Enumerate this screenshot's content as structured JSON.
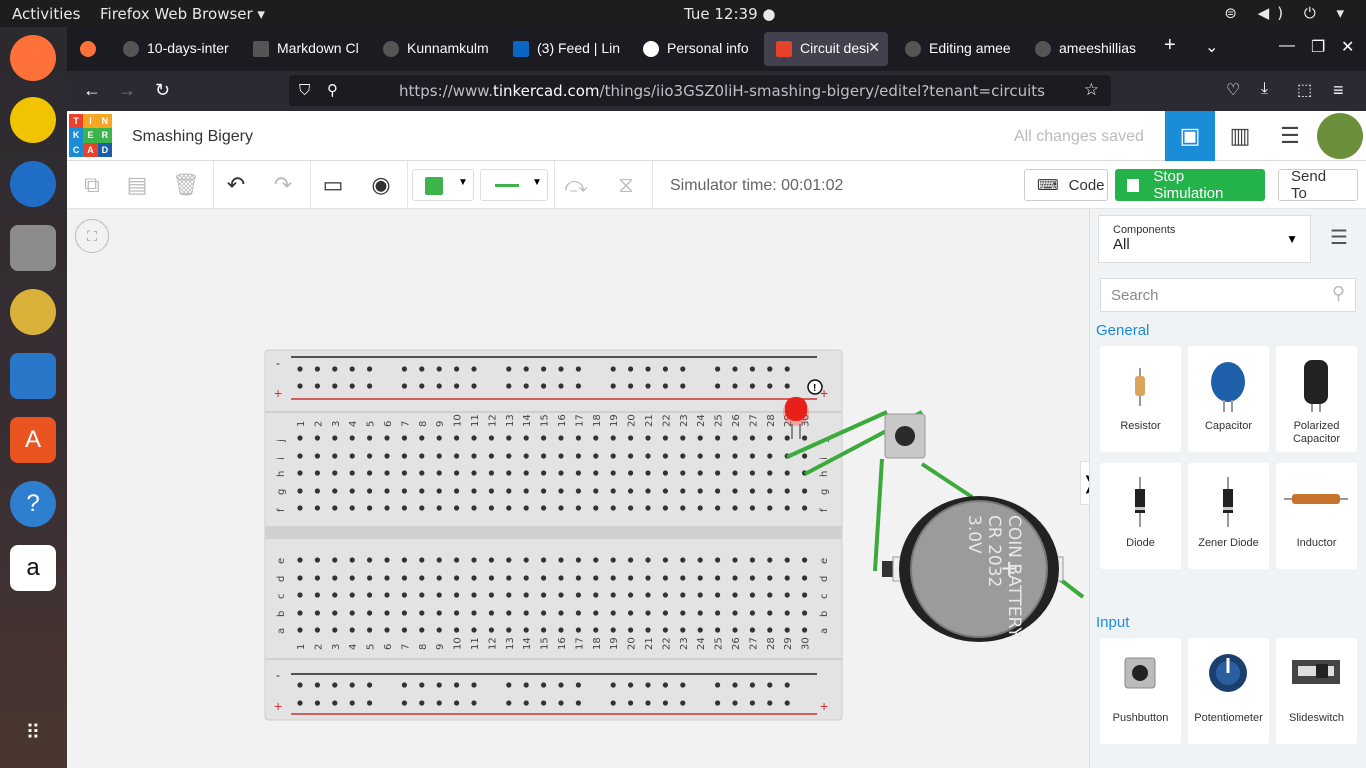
{
  "os": {
    "activities": "Activities",
    "app_menu": "Firefox Web Browser ▾",
    "clock": "Tue 12:39 ●",
    "tray": "⊜ ◀) ⏻ ▾"
  },
  "dock": {
    "items": [
      "firefox-icon",
      "teapot-icon",
      "thunderbird-icon",
      "files-icon",
      "rhythmbox-icon",
      "writer-icon",
      "software-icon",
      "help-icon",
      "amazon-icon",
      "apps-grid-icon"
    ]
  },
  "tabs": [
    {
      "label": "10-days-inter",
      "active": false
    },
    {
      "label": "Markdown Cl",
      "active": false
    },
    {
      "label": "Kunnamkulm",
      "active": false
    },
    {
      "label": "(3) Feed | Lin",
      "active": false
    },
    {
      "label": "Personal info",
      "active": false
    },
    {
      "label": "Circuit desi",
      "active": true
    },
    {
      "label": "Editing amee",
      "active": false
    },
    {
      "label": "ameeshillias",
      "active": false
    }
  ],
  "tab_close": "✕",
  "new_tab": "+",
  "url": {
    "prefix": "https://www.",
    "host": "tinkercad.com",
    "path": "/things/iio3GSZ0liH-smashing-bigery/editel?tenant=circuits"
  },
  "tinkercad": {
    "logo": [
      "T",
      "I",
      "N",
      "K",
      "E",
      "R",
      "C",
      "A",
      "D"
    ],
    "project_name": "Smashing Bigery",
    "save_status": "All changes saved",
    "simulator_time": "Simulator time: 00:01:02",
    "code_label": "Code",
    "stop_label": "Stop Simulation",
    "send_label": "Send To"
  },
  "panel": {
    "components_label": "Components",
    "components_value": "All",
    "search_placeholder": "Search",
    "sections": [
      {
        "title": "General",
        "items": [
          "Resistor",
          "Capacitor",
          "Polarized Capacitor",
          "Diode",
          "Zener Diode",
          "Inductor"
        ]
      },
      {
        "title": "Input",
        "items": [
          "Pushbutton",
          "Potentiometer",
          "Slideswitch"
        ]
      }
    ]
  },
  "breadboard": {
    "rows_top": [
      "j",
      "i",
      "h",
      "g",
      "f"
    ],
    "rows_bottom": [
      "e",
      "d",
      "c",
      "b",
      "a"
    ],
    "columns": 30
  },
  "battery": {
    "line1": "COIN BATTERY",
    "line2": "CR 2032",
    "line3": "3.0V"
  },
  "colors": {
    "accent_blue": "#1a8cd8",
    "stop_green": "#24b24b",
    "wire_green": "#3aaa3a",
    "led_red": "#e8201a"
  }
}
